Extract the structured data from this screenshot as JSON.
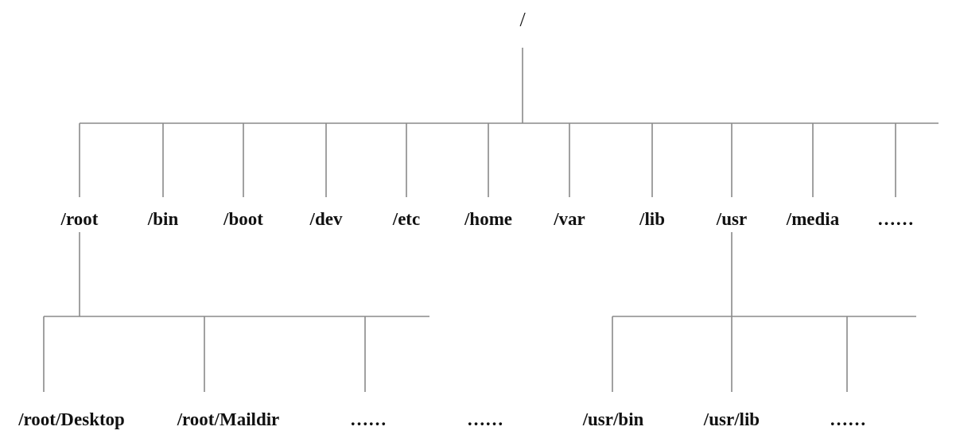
{
  "tree": {
    "label": "/",
    "children": [
      {
        "label": "/root",
        "children": [
          {
            "label": "/root/Desktop"
          },
          {
            "label": "/root/Maildir"
          },
          {
            "label": "……"
          }
        ]
      },
      {
        "label": "/bin"
      },
      {
        "label": "/boot"
      },
      {
        "label": "/dev"
      },
      {
        "label": "/etc"
      },
      {
        "label": "/home"
      },
      {
        "label": "/var"
      },
      {
        "label": "/lib"
      },
      {
        "label": "/usr",
        "children": [
          {
            "label": "/usr/bin"
          },
          {
            "label": "/usr/lib"
          },
          {
            "label": "……"
          }
        ]
      },
      {
        "label": "/media"
      },
      {
        "label": "……"
      }
    ]
  },
  "loose_labels": [
    "……"
  ]
}
